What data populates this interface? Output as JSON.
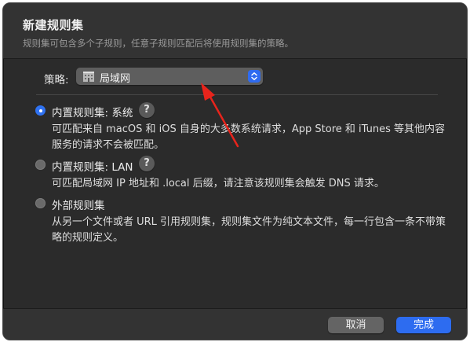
{
  "dialog": {
    "title": "新建规则集",
    "subtitle": "规则集可包含多个子规则，任意子规则匹配后将使用规则集的策略。"
  },
  "policy": {
    "label": "策略:",
    "selected": "局域网",
    "icon": "building-icon"
  },
  "options": [
    {
      "label": "内置规则集: 系统",
      "checked": true,
      "has_help": true,
      "description_lines": [
        "可匹配来自 macOS 和 iOS 自身的大多数系统请求，App Store 和 iTunes 等其他内容",
        "服务的请求不会被匹配。"
      ]
    },
    {
      "label": "内置规则集: LAN",
      "checked": false,
      "has_help": true,
      "description_lines": [
        "可匹配局域网 IP 地址和 .local 后缀，请注意该规则集会触发 DNS 请求。"
      ]
    },
    {
      "label": "外部规则集",
      "checked": false,
      "has_help": false,
      "description_lines": [
        "从另一个文件或者 URL 引用规则集，规则集文件为纯文本文件，每一行包含一条不带策",
        "略的规则定义。"
      ]
    }
  ],
  "help_symbol": "?",
  "buttons": {
    "cancel": "取消",
    "done": "完成"
  },
  "colors": {
    "accent": "#2d6cf0",
    "annotation_arrow": "#e8241c"
  }
}
